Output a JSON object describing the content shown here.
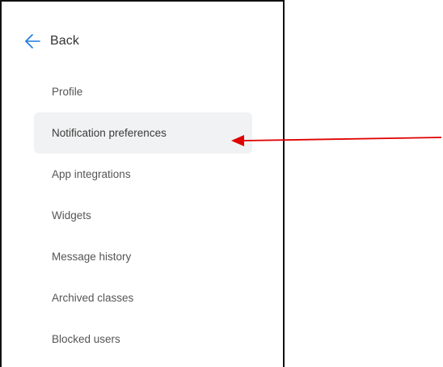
{
  "nav": {
    "back_label": "Back",
    "back_icon": "arrow-left-icon",
    "accent_color": "#1f7ae0"
  },
  "menu": {
    "items": [
      {
        "label": "Profile",
        "selected": false
      },
      {
        "label": "Notification preferences",
        "selected": true
      },
      {
        "label": "App integrations",
        "selected": false
      },
      {
        "label": "Widgets",
        "selected": false
      },
      {
        "label": "Message history",
        "selected": false
      },
      {
        "label": "Archived classes",
        "selected": false
      },
      {
        "label": "Blocked users",
        "selected": false
      }
    ]
  },
  "annotation": {
    "type": "arrow",
    "color": "#e00000",
    "points_to": "Notification preferences"
  }
}
